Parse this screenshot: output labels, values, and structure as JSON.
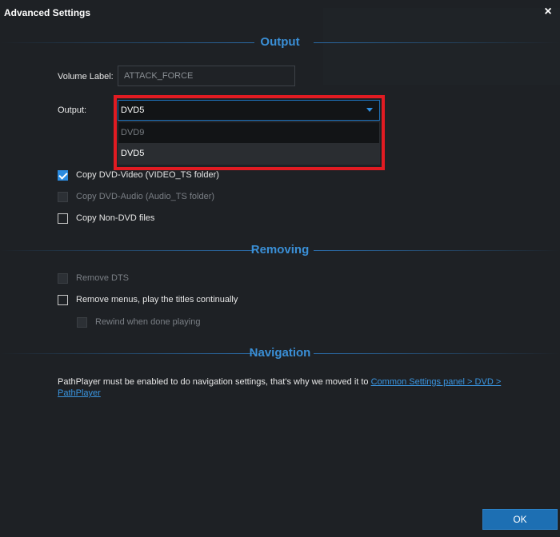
{
  "window": {
    "title": "Advanced Settings",
    "close_glyph": "×"
  },
  "output": {
    "section_title": "Output",
    "volume_label": {
      "label": "Volume Label:",
      "value": "ATTACK_FORCE"
    },
    "output_select": {
      "label": "Output:",
      "selected": "DVD5",
      "options": [
        "DVD9",
        "DVD5"
      ]
    },
    "checkboxes": [
      {
        "label": "Copy DVD-Video (VIDEO_TS folder)",
        "checked": true,
        "enabled": true
      },
      {
        "label": "Copy DVD-Audio (Audio_TS folder)",
        "checked": false,
        "enabled": false
      },
      {
        "label": "Copy Non-DVD files",
        "checked": false,
        "enabled": true
      }
    ]
  },
  "removing": {
    "section_title": "Removing",
    "checkboxes": [
      {
        "label": "Remove DTS",
        "checked": false,
        "enabled": false
      },
      {
        "label": "Remove menus, play the titles continually",
        "checked": false,
        "enabled": true
      },
      {
        "label": "Rewind when done playing",
        "checked": false,
        "enabled": false
      }
    ]
  },
  "navigation": {
    "section_title": "Navigation",
    "text": "PathPlayer must be enabled to do navigation settings, that's why we moved it to ",
    "link": "Common Settings panel > DVD > PathPlayer"
  },
  "footer": {
    "ok_label": "OK"
  },
  "colors": {
    "accent": "#2b8be0",
    "highlight_border": "#e11b22",
    "background": "#1e2125",
    "ok_button": "#1d6fb3"
  }
}
